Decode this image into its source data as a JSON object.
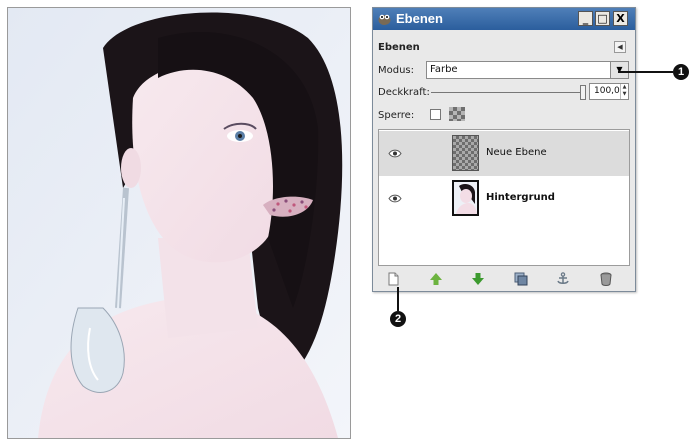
{
  "window": {
    "title": "Ebenen",
    "icon": "gimp-wilber-icon",
    "controls": {
      "minimize": "_",
      "maximize": "□",
      "close": "X"
    }
  },
  "dock": {
    "label": "Ebenen",
    "menu_icon": "dock-menu-arrow-icon"
  },
  "mode": {
    "label": "Modus:",
    "value": "Farbe"
  },
  "opacity": {
    "label": "Deckkraft:",
    "value": "100,0",
    "percent": 100
  },
  "lock": {
    "label": "Sperre:",
    "checked": false,
    "alpha_icon": "lock-alpha-checker-icon"
  },
  "layers": [
    {
      "name": "Neue Ebene",
      "visible": true,
      "selected": true,
      "thumb": "transparent"
    },
    {
      "name": "Hintergrund",
      "visible": true,
      "selected": false,
      "thumb": "photo"
    }
  ],
  "buttons": [
    {
      "name": "new-layer-button",
      "icon": "new-layer-icon"
    },
    {
      "name": "raise-layer-button",
      "icon": "arrow-up-icon"
    },
    {
      "name": "lower-layer-button",
      "icon": "arrow-down-icon"
    },
    {
      "name": "duplicate-layer-button",
      "icon": "duplicate-icon"
    },
    {
      "name": "anchor-layer-button",
      "icon": "anchor-icon"
    },
    {
      "name": "delete-layer-button",
      "icon": "trash-icon"
    }
  ],
  "callouts": [
    {
      "number": "1",
      "target": "mode-dropdown"
    },
    {
      "number": "2",
      "target": "new-layer-button"
    }
  ],
  "colors": {
    "titlebar": "#2b5e9d",
    "panel": "#e9e9e9",
    "selected_row": "#dcdcdc",
    "arrow_up": "#6cb33f",
    "arrow_down": "#3c9a2e"
  }
}
